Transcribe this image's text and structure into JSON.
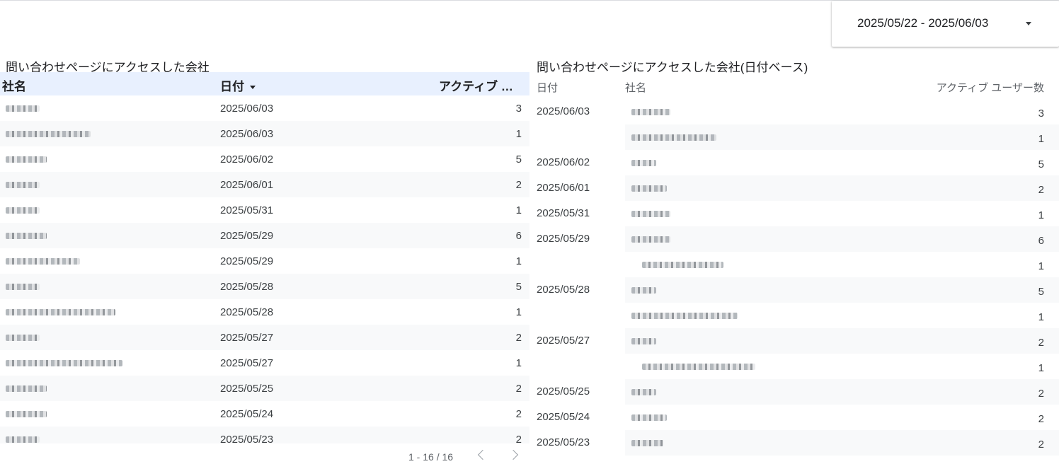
{
  "date_range": {
    "value": "2025/05/22 - 2025/06/03"
  },
  "left_table": {
    "title": "問い合わせページにアクセスした会社",
    "headers": {
      "company": "社名",
      "date": "日付",
      "users": "アクティブ …"
    },
    "rows": [
      {
        "date": "2025/06/03",
        "users": "3"
      },
      {
        "date": "2025/06/03",
        "users": "1"
      },
      {
        "date": "2025/06/02",
        "users": "5"
      },
      {
        "date": "2025/06/01",
        "users": "2"
      },
      {
        "date": "2025/05/31",
        "users": "1"
      },
      {
        "date": "2025/05/29",
        "users": "6"
      },
      {
        "date": "2025/05/29",
        "users": "1"
      },
      {
        "date": "2025/05/28",
        "users": "5"
      },
      {
        "date": "2025/05/28",
        "users": "1"
      },
      {
        "date": "2025/05/27",
        "users": "2"
      },
      {
        "date": "2025/05/27",
        "users": "1"
      },
      {
        "date": "2025/05/25",
        "users": "2"
      },
      {
        "date": "2025/05/24",
        "users": "2"
      },
      {
        "date": "2025/05/23",
        "users": "2"
      }
    ],
    "pagination": {
      "text": "1 - 16 / 16"
    }
  },
  "right_table": {
    "title": "問い合わせページにアクセスした会社(日付ベース)",
    "headers": {
      "date": "日付",
      "company": "社名",
      "users": "アクティブ ユーザー数"
    },
    "dates": [
      "2025/06/03",
      "2025/06/02",
      "2025/06/01",
      "2025/05/31",
      "2025/05/29",
      "2025/05/28",
      "2025/05/27",
      "2025/05/25",
      "2025/05/24",
      "2025/05/23"
    ],
    "users": [
      "3",
      "1",
      "5",
      "2",
      "1",
      "6",
      "1",
      "5",
      "1",
      "2",
      "1",
      "2",
      "2",
      "2"
    ]
  },
  "colors": {
    "header_bg": "#e8f0fe",
    "stripe": "#f8f9fa",
    "text": "#202124"
  }
}
